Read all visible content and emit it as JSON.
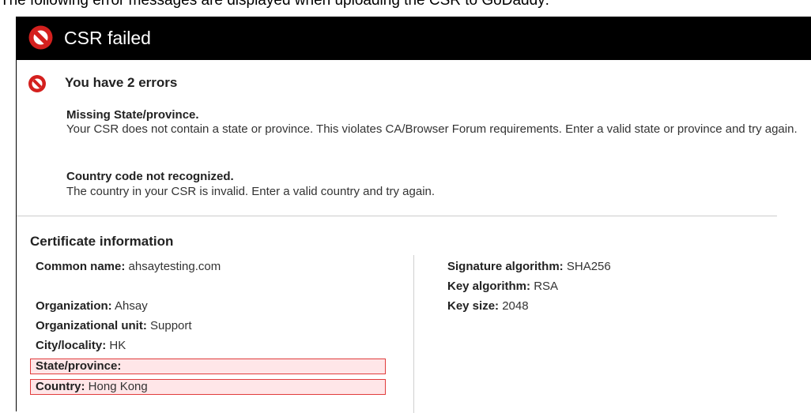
{
  "top_strip_text": "The following error messages are displayed when uploading the CSR to GoDaddy:",
  "dialog": {
    "title": "CSR failed",
    "error_heading": "You have 2 errors",
    "errors": [
      {
        "title": "Missing State/province.",
        "description": "Your CSR does not contain a state or province. This violates CA/Browser Forum requirements. Enter a valid state or province and try again."
      },
      {
        "title": "Country code not recognized.",
        "description": "The country in your CSR is invalid. Enter a valid country and try again."
      }
    ]
  },
  "certificate": {
    "section_title": "Certificate information",
    "left": [
      {
        "label": "Common name:",
        "value": "ahsaytesting.com",
        "highlighted": false
      },
      {
        "label": "Organization:",
        "value": "Ahsay",
        "highlighted": false
      },
      {
        "label": "Organizational unit:",
        "value": "Support",
        "highlighted": false
      },
      {
        "label": "City/locality:",
        "value": "HK",
        "highlighted": false
      },
      {
        "label": "State/province:",
        "value": "",
        "highlighted": true
      },
      {
        "label": "Country:",
        "value": "Hong Kong",
        "highlighted": true
      }
    ],
    "right": [
      {
        "label": "Signature algorithm:",
        "value": "SHA256"
      },
      {
        "label": "Key algorithm:",
        "value": "RSA"
      },
      {
        "label": "Key size:",
        "value": "2048"
      }
    ]
  },
  "colors": {
    "header_bg": "#000000",
    "error_icon": "#d4201e",
    "highlight_bg": "#ffe6e8",
    "highlight_border": "#e03c3c"
  },
  "icons": {
    "header_icon": "prohibited-icon",
    "error_icon": "prohibited-icon"
  }
}
